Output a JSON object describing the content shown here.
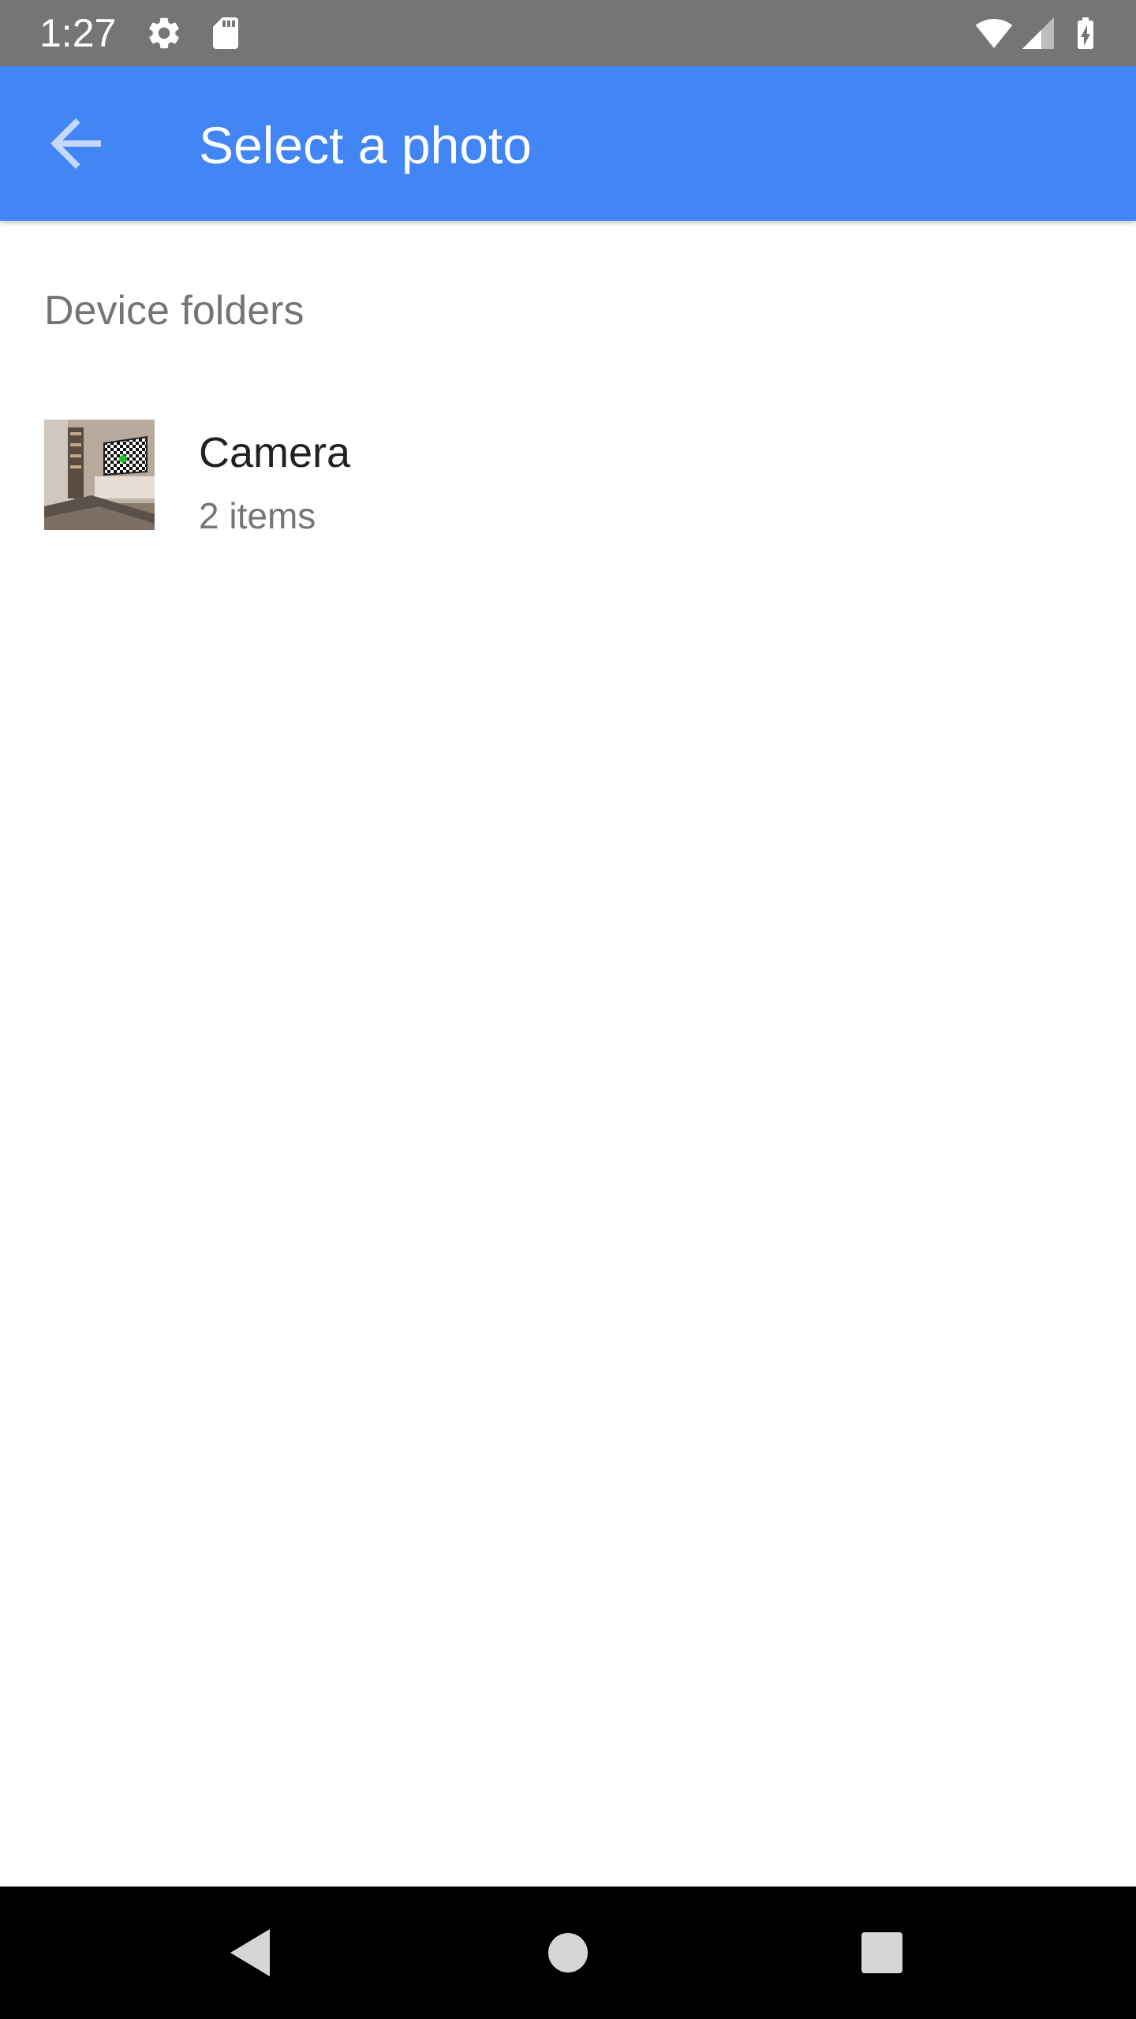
{
  "status_bar": {
    "time": "1:27",
    "icons": [
      "settings-icon",
      "sd-card-icon",
      "wifi-icon",
      "cell-signal-icon",
      "battery-charging-icon"
    ]
  },
  "app_bar": {
    "title": "Select a photo",
    "back_icon": "arrow-back-icon",
    "background_color": "#4285f4"
  },
  "content": {
    "section_header": "Device folders",
    "folders": [
      {
        "name": "Camera",
        "count": "2 items",
        "thumbnail_icon": "folder-thumbnail"
      }
    ]
  },
  "nav_bar": {
    "icons": [
      "nav-back-icon",
      "nav-home-icon",
      "nav-recents-icon"
    ]
  }
}
